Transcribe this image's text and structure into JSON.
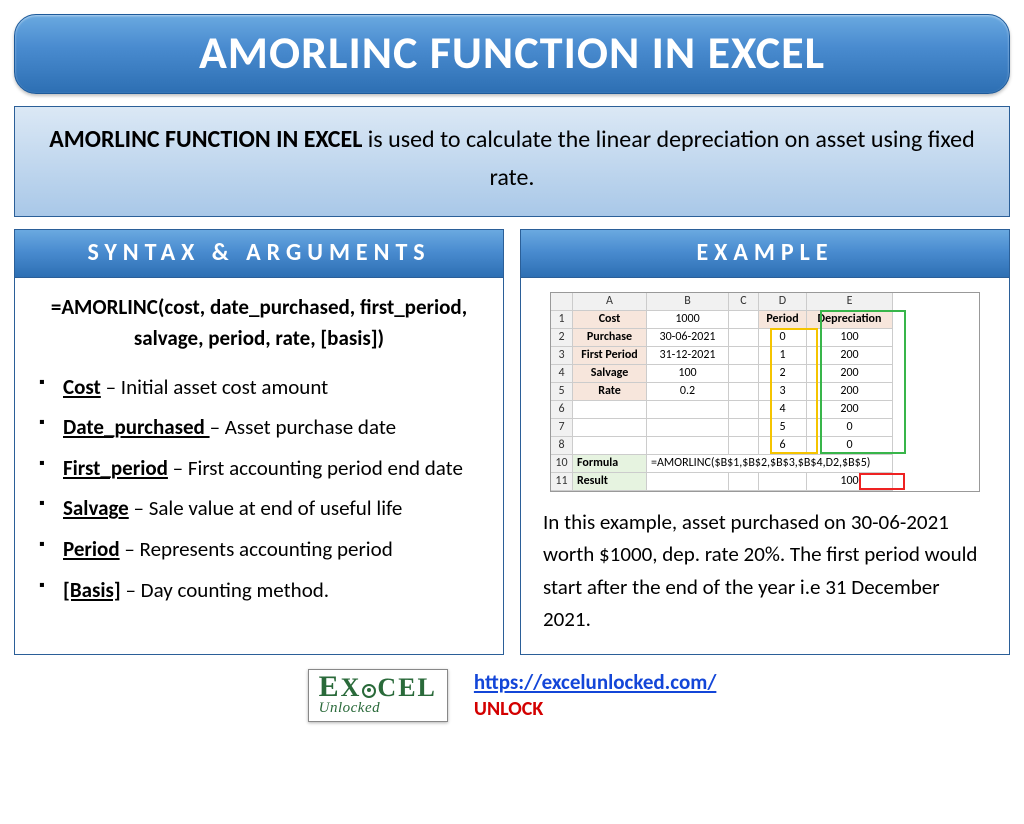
{
  "title": "AMORLINC FUNCTION IN EXCEL",
  "intro": {
    "bold": "AMORLINC FUNCTION IN EXCEL",
    "rest": " is used to calculate the linear depreciation on asset using fixed rate."
  },
  "syntax_header": "SYNTAX & ARGUMENTS",
  "example_header": "EXAMPLE",
  "syntax_formula": "=AMORLINC(cost, date_purchased, first_period, salvage, period, rate, [basis])",
  "args": [
    {
      "name": "Cost",
      "desc": " – Initial asset cost amount"
    },
    {
      "name": "Date_purchased ",
      "desc": "– Asset purchase date"
    },
    {
      "name": "First_period",
      "desc": " – First accounting period end date"
    },
    {
      "name": "Salvage",
      "desc": " – Sale value at end of useful life"
    },
    {
      "name": "Period",
      "desc": " – Represents accounting period"
    },
    {
      "name": "[Basis]",
      "desc": " – Day counting method."
    }
  ],
  "sheet": {
    "cols": [
      "A",
      "B",
      "C",
      "D",
      "E"
    ],
    "labels": {
      "cost": "Cost",
      "purchase": "Purchase",
      "first_period": "First Period",
      "salvage": "Salvage",
      "rate": "Rate",
      "period": "Period",
      "depreciation": "Depreciation",
      "formula": "Formula",
      "result": "Result"
    },
    "values": {
      "cost": "1000",
      "purchase": "30-06-2021",
      "first_period": "31-12-2021",
      "salvage": "100",
      "rate": "0.2"
    },
    "periods": [
      "0",
      "1",
      "2",
      "3",
      "4",
      "5",
      "6"
    ],
    "depreciation": [
      "100",
      "200",
      "200",
      "200",
      "200",
      "0",
      "0"
    ],
    "formula_text": "=AMORLINC($B$1,$B$2,$B$3,$B$4,D2,$B$5)",
    "result_value": "100"
  },
  "example_text": "In this example, asset purchased on 30-06-2021 worth $1000, dep. rate 20%. The first period would start after the end of the year i.e 31 December 2021.",
  "footer": {
    "logo_top": "EXCEL",
    "logo_sub": "Unlocked",
    "url": "https://excelunlocked.com/",
    "unlock": "UNLOCK"
  },
  "chart_data": {
    "type": "table",
    "title": "AMORLINC depreciation schedule example",
    "inputs": {
      "cost": 1000,
      "purchase_date": "30-06-2021",
      "first_period_end": "31-12-2021",
      "salvage": 100,
      "rate": 0.2
    },
    "columns": [
      "Period",
      "Depreciation"
    ],
    "rows": [
      [
        0,
        100
      ],
      [
        1,
        200
      ],
      [
        2,
        200
      ],
      [
        3,
        200
      ],
      [
        4,
        200
      ],
      [
        5,
        0
      ],
      [
        6,
        0
      ]
    ],
    "formula": "=AMORLINC($B$1,$B$2,$B$3,$B$4,D2,$B$5)",
    "result": 100
  }
}
